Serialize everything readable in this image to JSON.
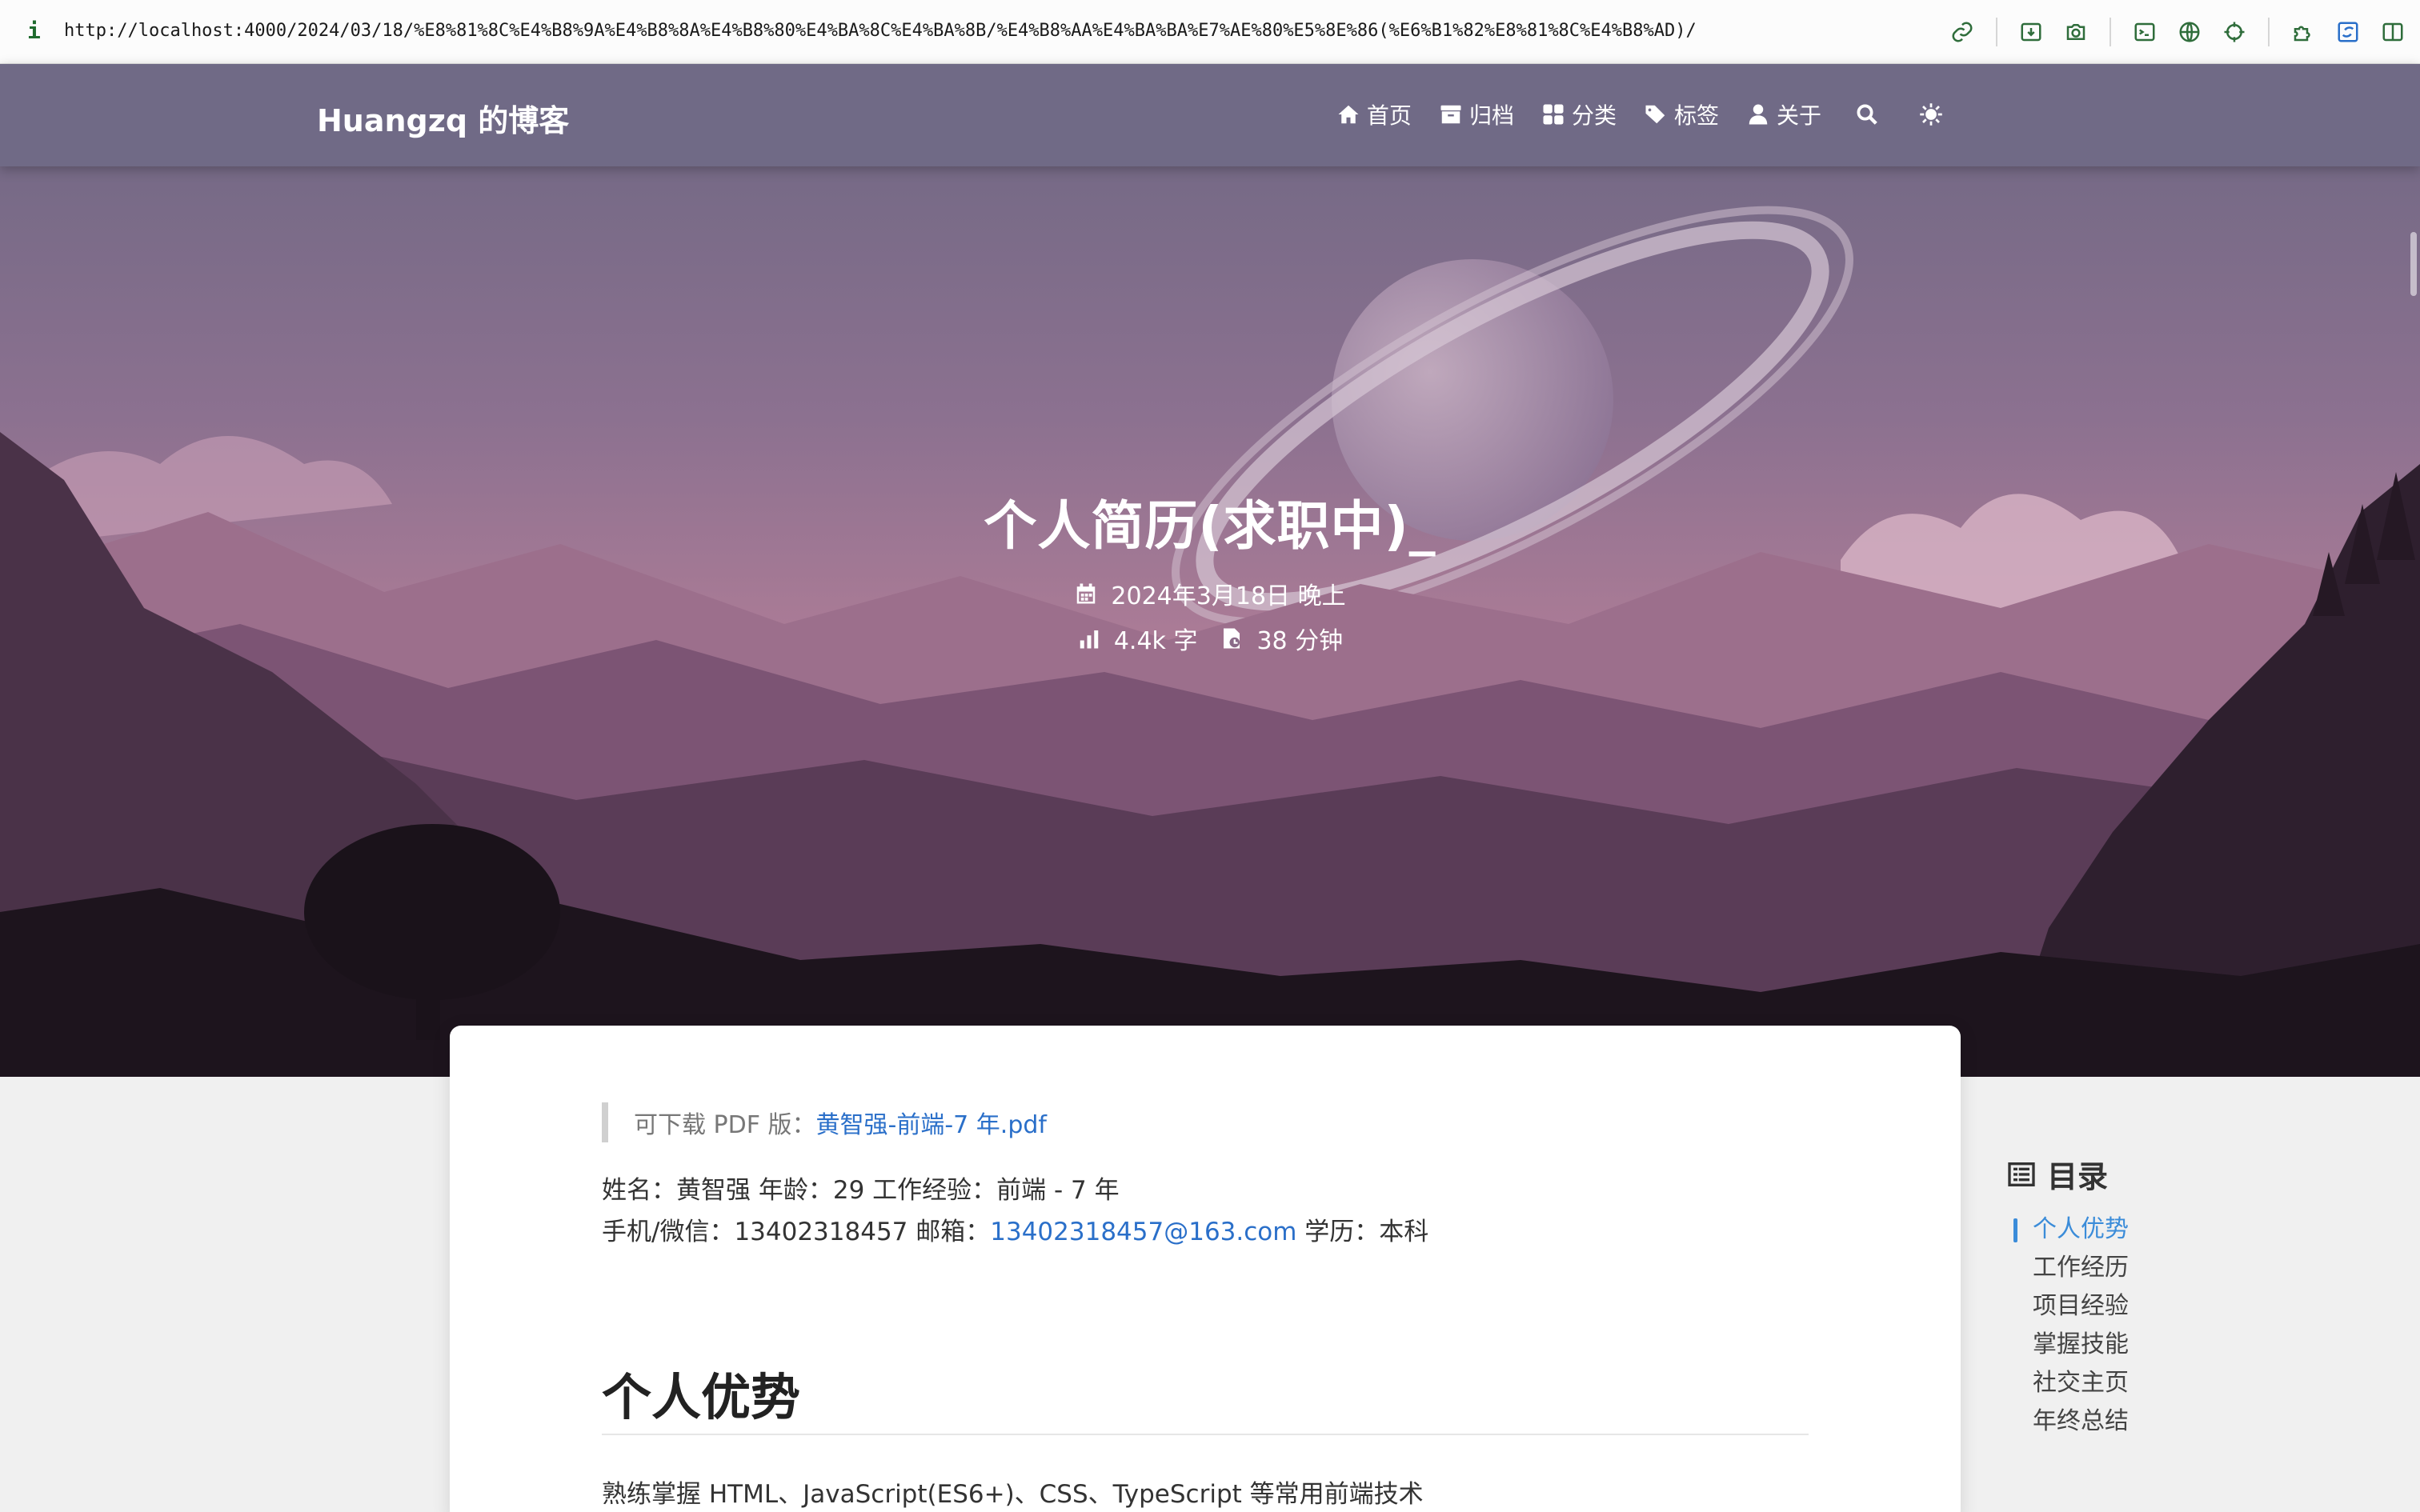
{
  "browser": {
    "info_glyph": "i",
    "url": "http://localhost:4000/2024/03/18/%E8%81%8C%E4%B8%9A%E4%B8%8A%E4%B8%80%E4%BA%8C%E4%BA%8B/%E4%B8%AA%E4%BA%BA%E7%AE%80%E5%8E%86(%E6%B1%82%E8%81%8C%E4%B8%AD)/",
    "tools": [
      "link-icon",
      "download-icon",
      "camera-icon",
      "terminal-icon",
      "globe-icon",
      "crosshair-icon",
      "extension-icon",
      "sync-icon",
      "sidebar-icon"
    ]
  },
  "nav": {
    "site_title": "Huangzq 的博客",
    "items": [
      {
        "label": "首页",
        "icon": "home-icon"
      },
      {
        "label": "归档",
        "icon": "archive-icon"
      },
      {
        "label": "分类",
        "icon": "grid-icon"
      },
      {
        "label": "标签",
        "icon": "tags-icon"
      },
      {
        "label": "关于",
        "icon": "user-icon"
      }
    ],
    "search_icon": "search-icon",
    "theme_icon": "sun-icon"
  },
  "hero": {
    "title": "个人简历(求职中)_",
    "date": "2024年3月18日 晚上",
    "word_count": "4.4k 字",
    "read_time": "38 分钟"
  },
  "article": {
    "quote_prefix": "可下载 PDF 版：",
    "quote_link": "黄智强-前端-7 年.pdf",
    "line1": "姓名：黄智强 年龄：29 工作经验：前端 - 7 年",
    "line2_prefix": "手机/微信：13402318457 邮箱：",
    "line2_email": "13402318457@163.com",
    "line2_suffix": " 学历：本科",
    "section_title": "个人优势",
    "paragraph": "熟练掌握 HTML、JavaScript(ES6+)、CSS、TypeScript 等常用前端技术"
  },
  "toc": {
    "title": "目录",
    "items": [
      "个人优势",
      "工作经历",
      "项目经验",
      "掌握技能",
      "社交主页",
      "年终总结"
    ],
    "active_index": 0
  },
  "colors": {
    "nav_bg": "#706a87",
    "link": "#2a6fc9",
    "toc_active": "#3b8cd9",
    "url_icon": "#2f6d3b"
  }
}
